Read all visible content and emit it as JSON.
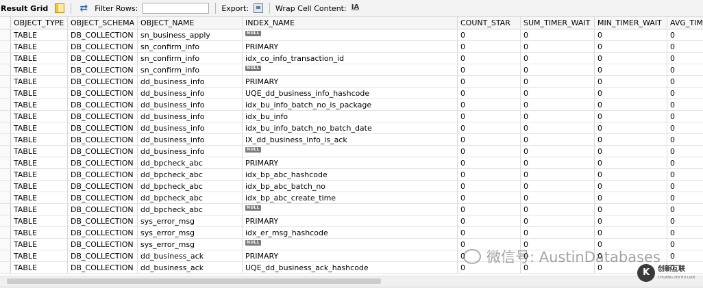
{
  "toolbar": {
    "title": "Result Grid",
    "filter_label": "Filter Rows:",
    "filter_value": "",
    "export_label": "Export:",
    "wrap_label": "Wrap Cell Content:",
    "wrap_icon_text": "IA",
    "icons": [
      "grid-icon",
      "refresh-filter-icon",
      "export-icon",
      "wrap-text-icon"
    ]
  },
  "columns": [
    "OBJECT_TYPE",
    "OBJECT_SCHEMA",
    "OBJECT_NAME",
    "INDEX_NAME",
    "COUNT_STAR",
    "SUM_TIMER_WAIT",
    "MIN_TIMER_WAIT",
    "AVG_TIM"
  ],
  "null_label": "NULL",
  "rows": [
    [
      "TABLE",
      "DB_COLLECTION",
      "sn_business_apply",
      null,
      "0",
      "0",
      "0",
      "0"
    ],
    [
      "TABLE",
      "DB_COLLECTION",
      "sn_confirm_info",
      "PRIMARY",
      "0",
      "0",
      "0",
      "0"
    ],
    [
      "TABLE",
      "DB_COLLECTION",
      "sn_confirm_info",
      "idx_co_info_transaction_id",
      "0",
      "0",
      "0",
      "0"
    ],
    [
      "TABLE",
      "DB_COLLECTION",
      "sn_confirm_info",
      null,
      "0",
      "0",
      "0",
      "0"
    ],
    [
      "TABLE",
      "DB_COLLECTION",
      "dd_business_info",
      "PRIMARY",
      "0",
      "0",
      "0",
      "0"
    ],
    [
      "TABLE",
      "DB_COLLECTION",
      "dd_business_info",
      "UQE_dd_business_info_hashcode",
      "0",
      "0",
      "0",
      "0"
    ],
    [
      "TABLE",
      "DB_COLLECTION",
      "dd_business_info",
      "idx_bu_info_batch_no_is_package",
      "0",
      "0",
      "0",
      "0"
    ],
    [
      "TABLE",
      "DB_COLLECTION",
      "dd_business_info",
      "idx_bu_info",
      "0",
      "0",
      "0",
      "0"
    ],
    [
      "TABLE",
      "DB_COLLECTION",
      "dd_business_info",
      "idx_bu_info_batch_no_batch_date",
      "0",
      "0",
      "0",
      "0"
    ],
    [
      "TABLE",
      "DB_COLLECTION",
      "dd_business_info",
      "IX_dd_business_info_is_ack",
      "0",
      "0",
      "0",
      "0"
    ],
    [
      "TABLE",
      "DB_COLLECTION",
      "dd_business_info",
      null,
      "0",
      "0",
      "0",
      "0"
    ],
    [
      "TABLE",
      "DB_COLLECTION",
      "dd_bpcheck_abc",
      "PRIMARY",
      "0",
      "0",
      "0",
      "0"
    ],
    [
      "TABLE",
      "DB_COLLECTION",
      "dd_bpcheck_abc",
      "idx_bp_abc_hashcode",
      "0",
      "0",
      "0",
      "0"
    ],
    [
      "TABLE",
      "DB_COLLECTION",
      "dd_bpcheck_abc",
      "idx_bp_abc_batch_no",
      "0",
      "0",
      "0",
      "0"
    ],
    [
      "TABLE",
      "DB_COLLECTION",
      "dd_bpcheck_abc",
      "idx_bp_abc_create_time",
      "0",
      "0",
      "0",
      "0"
    ],
    [
      "TABLE",
      "DB_COLLECTION",
      "dd_bpcheck_abc",
      null,
      "0",
      "0",
      "0",
      "0"
    ],
    [
      "TABLE",
      "DB_COLLECTION",
      "sys_error_msg",
      "PRIMARY",
      "0",
      "0",
      "0",
      "0"
    ],
    [
      "TABLE",
      "DB_COLLECTION",
      "sys_error_msg",
      "idx_er_msg_hashcode",
      "0",
      "0",
      "0",
      "0"
    ],
    [
      "TABLE",
      "DB_COLLECTION",
      "sys_error_msg",
      null,
      "0",
      "0",
      "0",
      "0"
    ],
    [
      "TABLE",
      "DB_COLLECTION",
      "dd_business_ack",
      "PRIMARY",
      "0",
      "0",
      "0",
      "0"
    ],
    [
      "TABLE",
      "DB_COLLECTION",
      "dd_business_ack",
      "UQE_dd_business_ack_hashcode",
      "0",
      "0",
      "0",
      "0"
    ]
  ],
  "watermark": {
    "text": "微信号: AustinDatabases",
    "logo_cn": "创新互联",
    "logo_en": "CHUANG XIN HU LIAN",
    "logo_mark": "K"
  },
  "colors": {
    "header_bg": "#f6f6f6",
    "toolbar_bg": "#f3f3f3",
    "null_badge": "#7a7a7a"
  }
}
